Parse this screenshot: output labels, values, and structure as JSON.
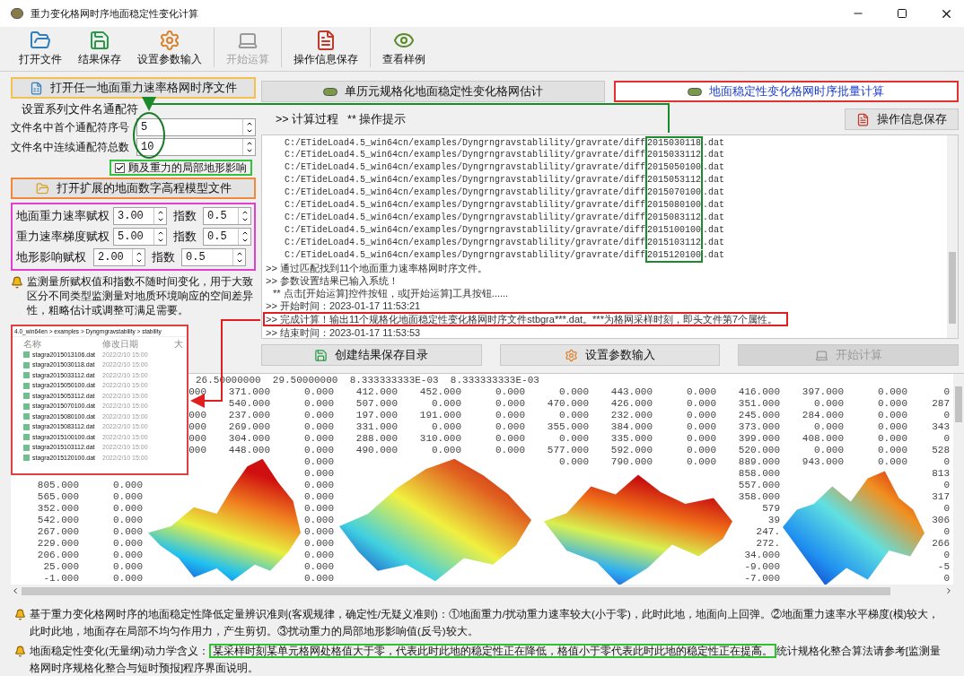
{
  "window": {
    "title": "重力变化格网时序地面稳定性变化计算"
  },
  "toolbar": [
    {
      "label": "打开文件",
      "disabled": false
    },
    {
      "label": "结果保存",
      "disabled": false
    },
    {
      "label": "设置参数输入",
      "disabled": false
    },
    {
      "label": "开始运算",
      "disabled": true
    },
    {
      "label": "操作信息保存",
      "disabled": false
    },
    {
      "label": "查看样例",
      "disabled": false
    }
  ],
  "left_panel": {
    "open_button": "打开任一地面重力速率格网时序文件",
    "wildcard_group": {
      "title": "设置系列文件名通配符",
      "fields": [
        {
          "label": "文件名中首个通配符序号",
          "value": "5"
        },
        {
          "label": "文件名中连续通配符总数",
          "value": "10"
        }
      ]
    },
    "terrain_checkbox": {
      "label": "顾及重力的局部地形影响",
      "checked": true
    },
    "dem_button": "打开扩展的地面数字高程模型文件",
    "weights": [
      {
        "label": "地面重力速率赋权",
        "value": "3.00",
        "exponent_label": "指数",
        "exponent": "0.5"
      },
      {
        "label": "重力速率梯度赋权",
        "value": "5.00",
        "exponent_label": "指数",
        "exponent": "0.5"
      },
      {
        "label": "地形影响赋权",
        "value": "2.00",
        "exponent_label": "指数",
        "exponent": "0.5"
      }
    ],
    "note": "监测量所赋权值和指数不随时间变化，用于大致区分不同类型监测量对地质环境响应的空间差异性，粗略估计或调整可满足需要。"
  },
  "right_panel": {
    "mode_tabs": [
      {
        "label": "单历元规格化地面稳定性变化格网估计",
        "selected": false
      },
      {
        "label": "地面稳定性变化格网时序批量计算",
        "selected": true
      }
    ],
    "log_title": ">> 计算过程",
    "log_hint": "** 操作提示",
    "save_button": "操作信息保存",
    "log": [
      {
        "kind": "path",
        "text": "C:/ETideLoad4.5_win64cn/examples/Dyngrngravstablility/gravrate/diff2015030118.dat"
      },
      {
        "kind": "path",
        "text": "C:/ETideLoad4.5_win64cn/examples/Dyngrngravstablility/gravrate/diff2015033112.dat"
      },
      {
        "kind": "path",
        "text": "C:/ETideLoad4.5_win64cn/examples/Dyngrngravstablility/gravrate/diff2015050100.dat"
      },
      {
        "kind": "path",
        "text": "C:/ETideLoad4.5_win64cn/examples/Dyngrngravstablility/gravrate/diff2015053112.dat"
      },
      {
        "kind": "path",
        "text": "C:/ETideLoad4.5_win64cn/examples/Dyngrngravstablility/gravrate/diff2015070100.dat"
      },
      {
        "kind": "path",
        "text": "C:/ETideLoad4.5_win64cn/examples/Dyngrngravstablility/gravrate/diff2015080100.dat"
      },
      {
        "kind": "path",
        "text": "C:/ETideLoad4.5_win64cn/examples/Dyngrngravstablility/gravrate/diff2015083112.dat"
      },
      {
        "kind": "path",
        "text": "C:/ETideLoad4.5_win64cn/examples/Dyngrngravstablility/gravrate/diff2015100100.dat"
      },
      {
        "kind": "path",
        "text": "C:/ETideLoad4.5_win64cn/examples/Dyngrngravstablility/gravrate/diff2015103112.dat"
      },
      {
        "kind": "path",
        "text": "C:/ETideLoad4.5_win64cn/examples/Dyngrngravstablility/gravrate/diff2015120100.dat"
      },
      {
        "kind": "message",
        "text": ">> 通过匹配找到11个地面重力速率格网时序文件。"
      },
      {
        "kind": "message",
        "text": ">> 参数设置结果已输入系统！"
      },
      {
        "kind": "hint",
        "text": "** 点击[开始运算]控件按钮，或[开始运算]工具按钮......"
      },
      {
        "kind": "message",
        "text": ">> 开始时间：2023-01-17 11:53:21"
      },
      {
        "kind": "result",
        "text": ">> 完成计算！输出11个规格化地面稳定性变化格网时序文件stbgra***.dat。***为格网采样时刻，即头文件第7个属性。"
      },
      {
        "kind": "message",
        "text": ">> 结束时间：2023-01-17 11:53:53"
      }
    ],
    "buttons": [
      {
        "label": "创建结果保存目录",
        "disabled": false
      },
      {
        "label": "设置参数输入",
        "disabled": false
      },
      {
        "label": "开始计算",
        "disabled": true
      }
    ]
  },
  "grid": {
    "header": "26.50000000  29.50000000  8.333333333E-03  8.333333333E-03",
    "rows": [
      [
        null,
        null,
        "000",
        "371.000",
        "0.000",
        "412.000",
        "452.000",
        "0.000",
        "0.000",
        "443.000",
        "0.000",
        "416.000",
        "397.000",
        "0.000",
        "0"
      ],
      [
        null,
        null,
        null,
        "540.000",
        "0.000",
        "507.000",
        "0.000",
        "0.000",
        "470.000",
        "426.000",
        "0.000",
        "351.000",
        "0.000",
        "0.000",
        "287"
      ],
      [
        null,
        null,
        "000",
        "237.000",
        "0.000",
        "197.000",
        "191.000",
        "0.000",
        "0.000",
        "232.000",
        "0.000",
        "245.000",
        "284.000",
        "0.000",
        "0"
      ],
      [
        null,
        null,
        "000",
        "269.000",
        "0.000",
        "331.000",
        "0.000",
        "0.000",
        "355.000",
        "384.000",
        "0.000",
        "373.000",
        "0.000",
        "0.000",
        "343"
      ],
      [
        null,
        null,
        "000",
        "304.000",
        "0.000",
        "288.000",
        "310.000",
        "0.000",
        "0.000",
        "335.000",
        "0.000",
        "399.000",
        "408.000",
        "0.000",
        "0"
      ],
      [
        null,
        null,
        "000",
        "448.000",
        "0.000",
        "490.000",
        "0.000",
        "0.000",
        "577.000",
        "592.000",
        "0.000",
        "520.000",
        "0.000",
        "0.000",
        "528"
      ],
      [
        null,
        null,
        null,
        null,
        "0.000",
        null,
        null,
        null,
        "0.000",
        "790.000",
        "0.000",
        "889.000",
        "943.000",
        "0.000",
        "0"
      ],
      [
        null,
        null,
        null,
        null,
        "0.000",
        null,
        null,
        null,
        null,
        null,
        null,
        "858.000",
        null,
        null,
        "813"
      ],
      [
        "805.000",
        "0.000",
        null,
        null,
        "0.000",
        null,
        null,
        null,
        null,
        null,
        null,
        "557.000",
        null,
        null,
        "0"
      ],
      [
        "565.000",
        "0.000",
        null,
        null,
        "0.000",
        null,
        null,
        null,
        null,
        null,
        null,
        "358.000",
        null,
        null,
        "317"
      ],
      [
        "352.000",
        "0.000",
        null,
        null,
        "0.000",
        null,
        null,
        null,
        null,
        null,
        null,
        "579",
        null,
        null,
        "0"
      ],
      [
        "542.000",
        "0.000",
        null,
        null,
        "0.000",
        null,
        null,
        null,
        null,
        null,
        null,
        "39",
        null,
        null,
        "306"
      ],
      [
        "267.000",
        "0.000",
        null,
        null,
        "0.000",
        null,
        null,
        null,
        null,
        null,
        null,
        "247.",
        null,
        null,
        "0"
      ],
      [
        "229.000",
        "0.000",
        null,
        null,
        "0.000",
        null,
        null,
        null,
        null,
        null,
        null,
        "272.",
        null,
        null,
        "266"
      ],
      [
        "206.000",
        "0.000",
        null,
        null,
        "0.000",
        null,
        null,
        null,
        null,
        null,
        null,
        "34.000",
        null,
        null,
        "0"
      ],
      [
        "25.000",
        "0.000",
        null,
        null,
        "0.000",
        null,
        null,
        null,
        null,
        null,
        null,
        "-9.000",
        null,
        null,
        "-5"
      ],
      [
        "-1.000",
        "0.000",
        null,
        null,
        "0.000",
        null,
        null,
        null,
        null,
        null,
        null,
        "-7.000",
        null,
        null,
        "0"
      ]
    ]
  },
  "file_inset": {
    "breadcrumb": "4.0_win64en > examples > Dyngrngravstability > stability",
    "columns": [
      "名称",
      "修改日期",
      "大"
    ],
    "files": [
      {
        "name": "stagra2015013106.dat",
        "modified": "2022/2/10 15:00"
      },
      {
        "name": "stagra2015030118.dat",
        "modified": "2022/2/10 15:00"
      },
      {
        "name": "stagra2015033112.dat",
        "modified": "2022/2/10 15:00"
      },
      {
        "name": "stagra2015050100.dat",
        "modified": "2022/2/10 15:00"
      },
      {
        "name": "stagra2015053112.dat",
        "modified": "2022/2/10 15:00"
      },
      {
        "name": "stagra2015070100.dat",
        "modified": "2022/2/10 15:00"
      },
      {
        "name": "stagra2015080100.dat",
        "modified": "2022/2/10 15:00"
      },
      {
        "name": "stagra2015083112.dat",
        "modified": "2022/2/10 15:00"
      },
      {
        "name": "stagra2015100100.dat",
        "modified": "2022/2/10 15:00"
      },
      {
        "name": "stagra2015103112.dat",
        "modified": "2022/2/10 15:00"
      },
      {
        "name": "stagra2015120100.dat",
        "modified": "2022/2/10 15:00"
      }
    ]
  },
  "notes": [
    {
      "kind": "plain",
      "text": "基于重力变化格网时序的地面稳定性降低定量辨识准则(客观规律，确定性/无疑义准则)：①地面重力/扰动重力速率较大(小于零)，此时此地，地面向上回弹。②地面重力速率水平梯度(模)较大，此时此地，地面存在局部不均匀作用力，产生剪切。③扰动重力的局部地形影响值(反号)较大。"
    },
    {
      "kind": "boxed",
      "lead": "地面稳定性变化(无量纲)动力学含义：",
      "boxed": "某采样时刻某单元格网处格值大于零，代表此时此地的稳定性正在降低，格值小于零代表此时此地的稳定性正在提高。",
      "tail": "统计规格化整合算法请参考[监测量格网时序规格化整合与短时预报]程序界面说明。"
    }
  ]
}
